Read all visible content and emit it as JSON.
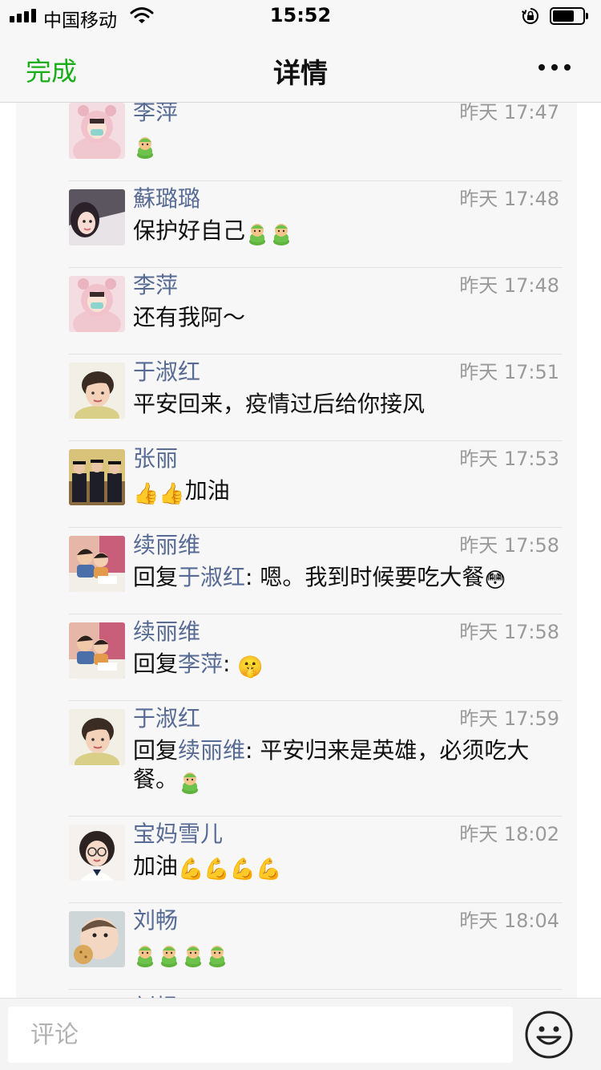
{
  "status_bar": {
    "carrier": "中国移动",
    "time": "15:52"
  },
  "nav": {
    "done_label": "完成",
    "title": "详情"
  },
  "comments": [
    {
      "name": "李萍",
      "time": "昨天 17:47",
      "avatar": "girl-pink-hood",
      "segments": [
        {
          "emoji": "🥷"
        }
      ]
    },
    {
      "name": "蘇璐璐",
      "time": "昨天 17:48",
      "avatar": "woman-selfie",
      "segments": [
        {
          "text": "保护好自己"
        },
        {
          "emoji": "🥷"
        },
        {
          "emoji": "🥷"
        }
      ]
    },
    {
      "name": "李萍",
      "time": "昨天 17:48",
      "avatar": "girl-pink-hood",
      "segments": [
        {
          "text": "还有我阿～"
        }
      ]
    },
    {
      "name": "于淑红",
      "time": "昨天 17:51",
      "avatar": "woman-short-hair",
      "segments": [
        {
          "text": "平安回来，疫情过后给你接风"
        }
      ]
    },
    {
      "name": "张丽",
      "time": "昨天 17:53",
      "avatar": "graduation-group",
      "segments": [
        {
          "emoji": "👍"
        },
        {
          "emoji": "👍"
        },
        {
          "text": "加油"
        }
      ]
    },
    {
      "name": "续丽维",
      "time": "昨天 17:58",
      "avatar": "kids-reading",
      "segments": [
        {
          "text": "回复"
        },
        {
          "reply": "于淑红"
        },
        {
          "text": ": 嗯。我到时候要吃大餐"
        },
        {
          "emoji": "😳"
        }
      ]
    },
    {
      "name": "续丽维",
      "time": "昨天 17:58",
      "avatar": "kids-reading",
      "segments": [
        {
          "text": "回复"
        },
        {
          "reply": "李萍"
        },
        {
          "text": ": "
        },
        {
          "emoji": "🤫"
        }
      ]
    },
    {
      "name": "于淑红",
      "time": "昨天 17:59",
      "avatar": "woman-short-hair",
      "segments": [
        {
          "text": "回复"
        },
        {
          "reply": "续丽维"
        },
        {
          "text": ": 平安归来是英雄，必须吃大餐。"
        },
        {
          "emoji": "🥷"
        }
      ]
    },
    {
      "name": "宝妈雪儿",
      "time": "昨天 18:02",
      "avatar": "girl-glasses",
      "segments": [
        {
          "text": "加油"
        },
        {
          "emoji": "💪"
        },
        {
          "emoji": "💪"
        },
        {
          "emoji": "💪"
        },
        {
          "emoji": "💪"
        }
      ]
    },
    {
      "name": "刘畅",
      "time": "昨天 18:04",
      "avatar": "baby-cookie",
      "segments": [
        {
          "emoji": "🥷"
        },
        {
          "emoji": "🥷"
        },
        {
          "emoji": "🥷"
        },
        {
          "emoji": "🥷"
        }
      ]
    },
    {
      "name": "刘畅",
      "time": "",
      "avatar": "baby-cookie",
      "segments": []
    }
  ],
  "input_bar": {
    "placeholder": "评论",
    "emoji_icon": "smiley-face-icon"
  },
  "colors": {
    "accent_green": "#1aad19",
    "link_blue": "#576b95",
    "panel_bg": "#f7f7f7"
  }
}
